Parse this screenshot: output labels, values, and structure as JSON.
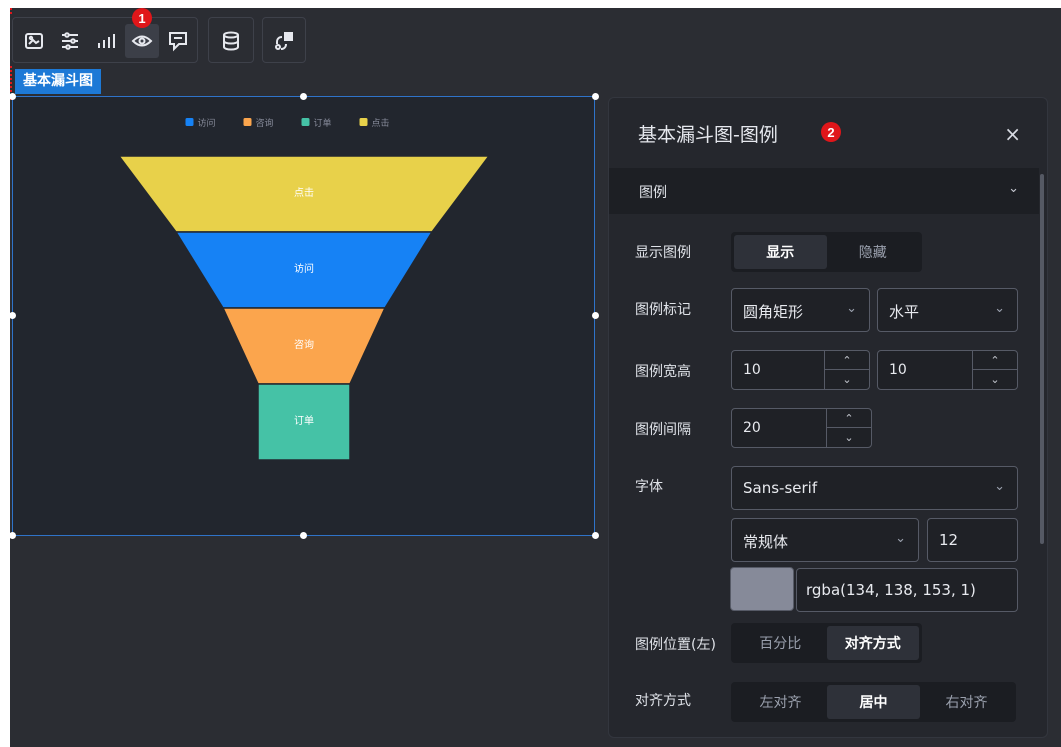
{
  "toolbar": {
    "icons": [
      "image-icon",
      "sliders-icon",
      "bar-chart-icon",
      "eye-icon",
      "comment-icon",
      "database-icon",
      "interaction-icon"
    ],
    "badge": "1"
  },
  "component": {
    "tag": "基本漏斗图"
  },
  "chart_data": {
    "type": "funnel",
    "legend": [
      "访问",
      "咨询",
      "订单",
      "点击"
    ],
    "legend_placement": "top-center",
    "stages": [
      {
        "name": "点击",
        "color": "#e8d14a"
      },
      {
        "name": "访问",
        "color": "#1682f5"
      },
      {
        "name": "咨询",
        "color": "#fba54d"
      },
      {
        "name": "订单",
        "color": "#45c2a6"
      }
    ],
    "legend_colors": [
      "#1682f5",
      "#fba54d",
      "#45c2a6",
      "#e8d14a"
    ]
  },
  "panel": {
    "title": "基本漏斗图-图例",
    "badge": "2",
    "close": "×",
    "section": "图例",
    "show_legend": {
      "label": "显示图例",
      "options": [
        "显示",
        "隐藏"
      ],
      "selected": "显示"
    },
    "legend_mark": {
      "label": "图例标记",
      "shape": "圆角矩形",
      "orient": "水平"
    },
    "legend_size": {
      "label": "图例宽高",
      "width": "10",
      "height": "10"
    },
    "legend_gap": {
      "label": "图例间隔",
      "value": "20"
    },
    "font": {
      "label": "字体",
      "family": "Sans-serif",
      "style": "常规体",
      "size": "12",
      "color": "rgba(134, 138, 153, 1)",
      "swatch": "#868a99"
    },
    "legend_pos": {
      "label": "图例位置(左)",
      "options": [
        "百分比",
        "对齐方式"
      ],
      "selected": "对齐方式"
    },
    "align": {
      "label": "对齐方式",
      "options": [
        "左对齐",
        "居中",
        "右对齐"
      ],
      "selected": "居中"
    }
  }
}
